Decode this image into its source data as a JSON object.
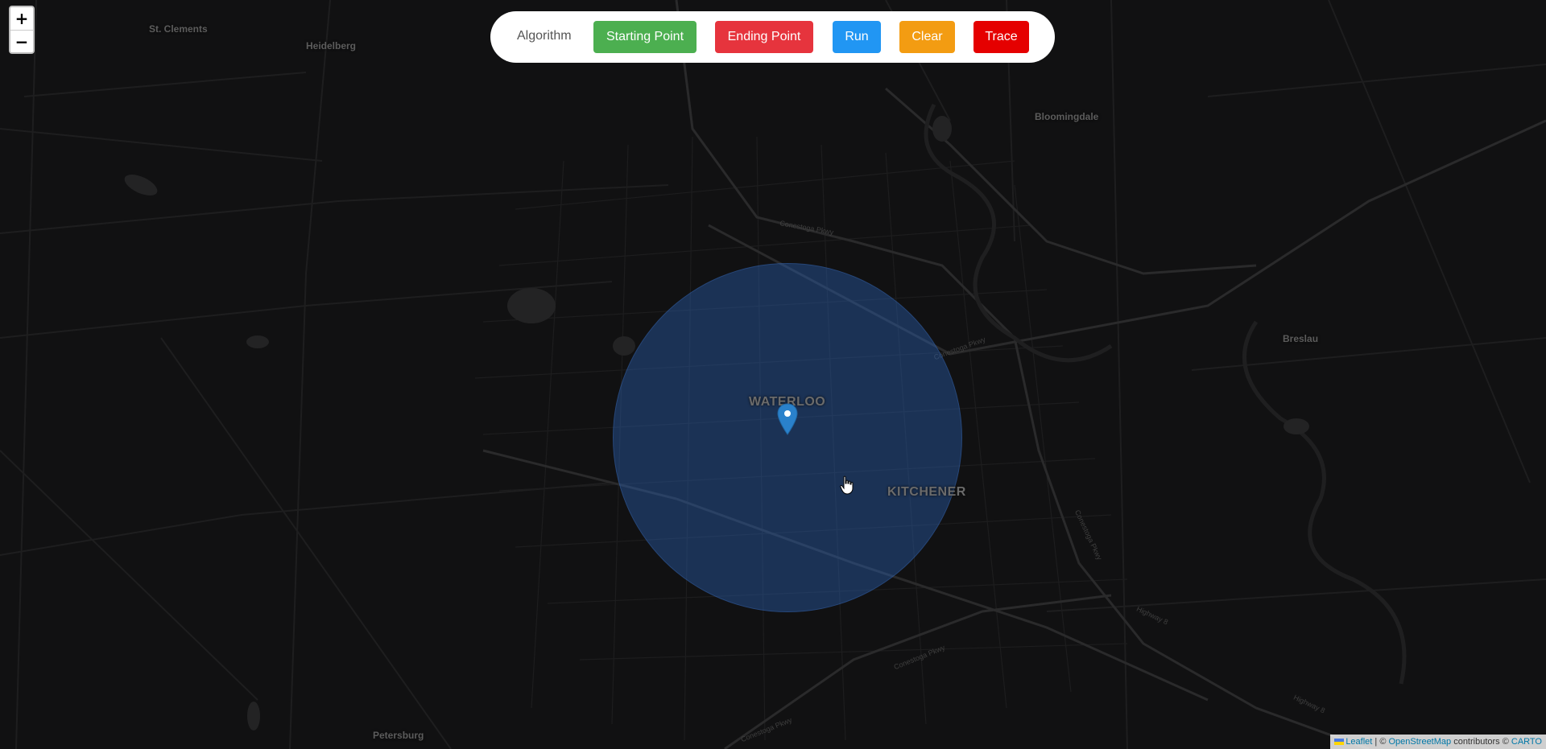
{
  "map": {
    "places": {
      "st_clements": "St. Clements",
      "heidelberg": "Heidelberg",
      "bloomingdale": "Bloomingdale",
      "breslau": "Breslau",
      "petersburg": "Petersburg"
    },
    "cities": {
      "waterloo": "WATERLOO",
      "kitchener": "KITCHENER"
    },
    "roads": {
      "conestoga_1": "Conestoga Pkwy",
      "conestoga_2": "Conestoga Pkwy",
      "conestoga_3": "Conestoga Pkwy",
      "conestoga_4": "Conestoga Pkwy",
      "conestoga_5": "Conestoga Pkwy",
      "highway_8": "Highway 8",
      "highway_8b": "Highway 8"
    },
    "colors": {
      "background": "#111112",
      "radius_fill": "#2c62b2",
      "marker": "#2a81cb"
    }
  },
  "zoom": {
    "in_label": "+",
    "out_label": "−"
  },
  "toolbar": {
    "algorithm_label": "Algorithm",
    "starting_point_label": "Starting Point",
    "ending_point_label": "Ending Point",
    "run_label": "Run",
    "clear_label": "Clear",
    "trace_label": "Trace",
    "colors": {
      "starting_point": "#4caf50",
      "ending_point": "#e6343d",
      "run": "#2196f3",
      "clear": "#f39c12",
      "trace": "#e50000"
    }
  },
  "attribution": {
    "leaflet": "Leaflet",
    "separator": " | © ",
    "osm": "OpenStreetMap",
    "contributors": " contributors © ",
    "carto": "CARTO"
  }
}
